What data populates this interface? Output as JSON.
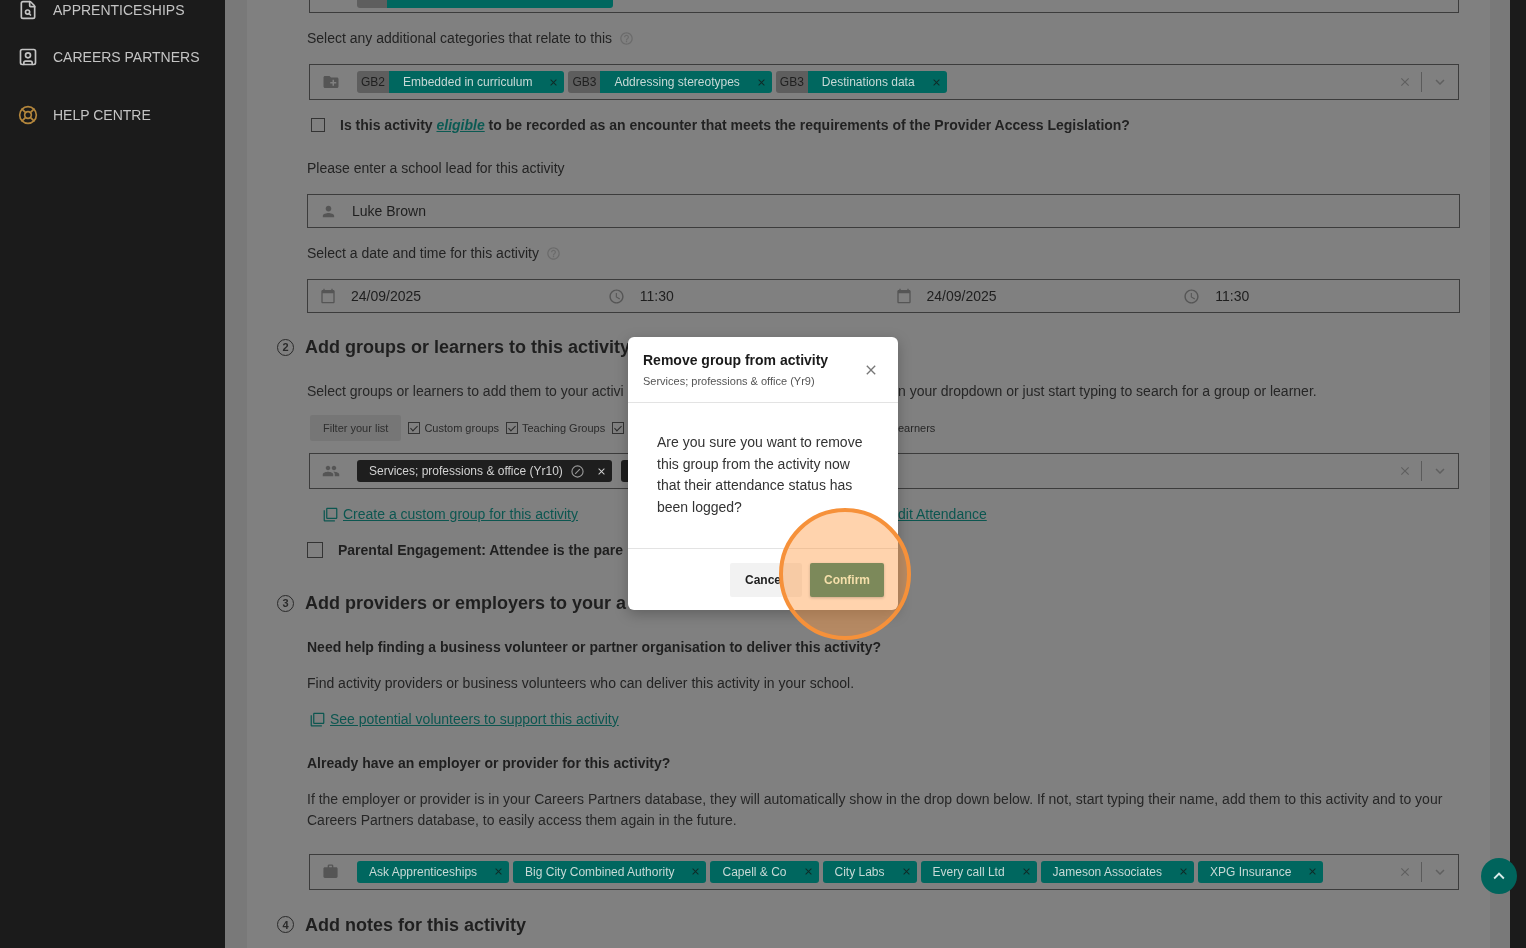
{
  "sidebar": {
    "items": [
      {
        "label": "APPRENTICESHIPS"
      },
      {
        "label": "CAREERS PARTNERS"
      },
      {
        "label": "HELP CENTRE"
      }
    ]
  },
  "details": {
    "categories": {
      "label": "Select any additional categories that relate to this",
      "chips": [
        {
          "code": "GB2",
          "label": "Embedded in curriculum"
        },
        {
          "code": "GB3",
          "label": "Addressing stereotypes"
        },
        {
          "code": "GB3",
          "label": "Destinations data"
        }
      ]
    },
    "eligibility": {
      "checked": false,
      "before": "Is this activity ",
      "link": "eligible",
      "after": " to be recorded as an encounter that meets the requirements of the Provider Access Legislation?"
    },
    "school_lead": {
      "label": "Please enter a school lead for this activity",
      "value": "Luke Brown"
    },
    "date_time": {
      "label": "Select a date and time for this activity",
      "fields": [
        {
          "kind": "date",
          "value": "24/09/2025"
        },
        {
          "kind": "time",
          "value": "11:30"
        },
        {
          "kind": "date",
          "value": "24/09/2025"
        },
        {
          "kind": "time",
          "value": "11:30"
        }
      ]
    }
  },
  "groups_section": {
    "number": "2",
    "title": "Add groups or learners to this activity",
    "intro_left": "Select groups or learners to add them to your activi",
    "intro_right": "n your dropdown or just start typing to search for a group or learner.",
    "filter": {
      "button": "Filter your list",
      "options": [
        {
          "label": "Custom groups",
          "checked": true
        },
        {
          "label": "Teaching Groups",
          "checked": true
        },
        {
          "checked": true
        }
      ],
      "trailing_text": "earners"
    },
    "groups": [
      {
        "label": "Services; professions & office (Yr10)"
      }
    ],
    "create_link": "Create a custom group for this activity",
    "attendance_link": "dit Attendance",
    "parental": {
      "checked": false,
      "label": "Parental Engagement: Attendee is the pare"
    }
  },
  "providers_section": {
    "number": "3",
    "title": "Add providers or employers to your a",
    "help_heading": "Need help finding a business volunteer or partner organisation to deliver this activity?",
    "help_text": "Find activity providers or business volunteers who can deliver this activity in your school.",
    "volunteers_link": "See potential volunteers to support this activity",
    "existing_heading": "Already have an employer or provider for this activity?",
    "existing_text": "If the employer or provider is in your Careers Partners database, they will automatically show in the drop down below. If not, start typing their name, add them to this activity and to your Careers Partners database, to easily access them again in the future.",
    "providers": [
      {
        "label": "Ask Apprenticeships"
      },
      {
        "label": "Big City Combined Authority"
      },
      {
        "label": "Capell & Co"
      },
      {
        "label": "City Labs"
      },
      {
        "label": "Every call Ltd"
      },
      {
        "label": "Jameson Associates"
      },
      {
        "label": "XPG Insurance"
      }
    ]
  },
  "notes_section": {
    "number": "4",
    "title": "Add notes for this activity"
  },
  "dialog": {
    "title": "Remove group from activity",
    "subtitle": "Services; professions & office (Yr9)",
    "message": "Are you sure you want to remove this group from the activity now that their attendance status has been logged?",
    "cancel": "Cance",
    "confirm": "Confirm"
  }
}
